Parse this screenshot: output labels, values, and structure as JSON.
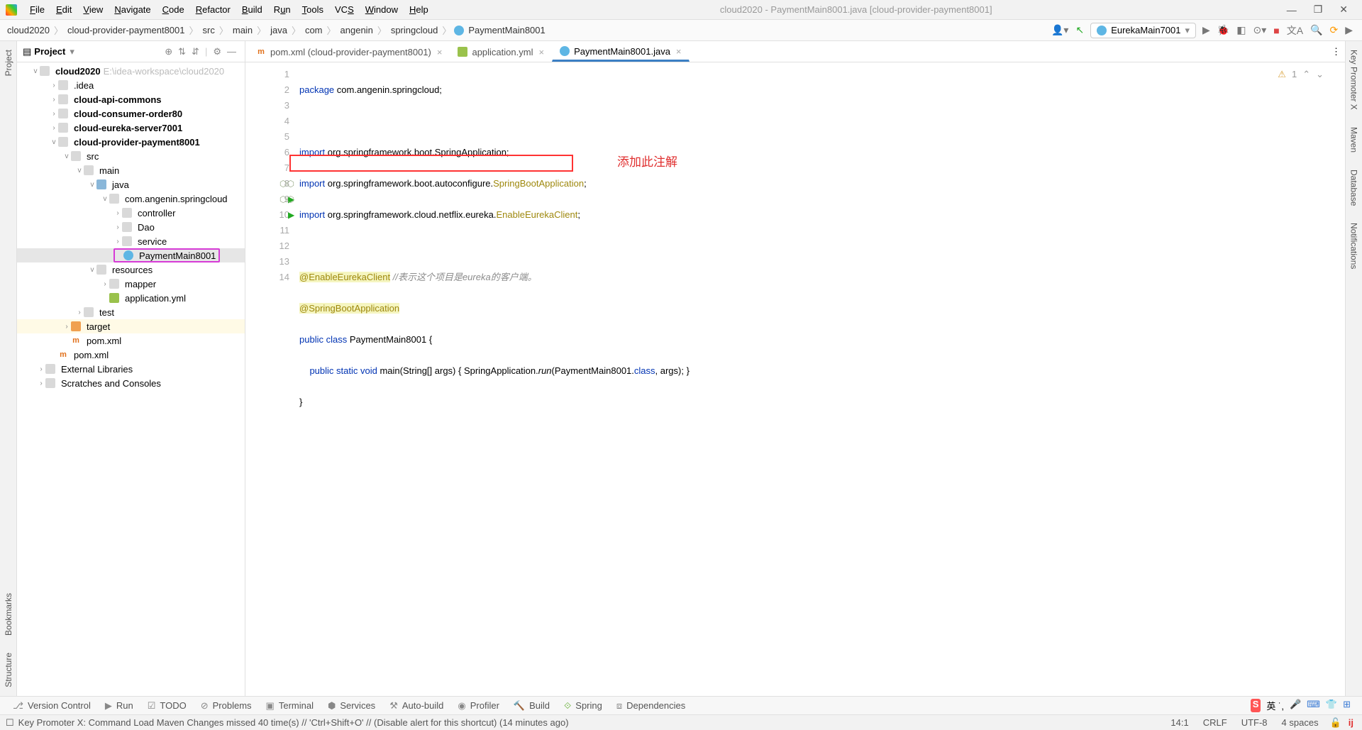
{
  "window": {
    "title": "cloud2020 - PaymentMain8001.java [cloud-provider-payment8001]"
  },
  "menu": [
    "File",
    "Edit",
    "View",
    "Navigate",
    "Code",
    "Refactor",
    "Build",
    "Run",
    "Tools",
    "VCS",
    "Window",
    "Help"
  ],
  "breadcrumbs": [
    "cloud2020",
    "cloud-provider-payment8001",
    "src",
    "main",
    "java",
    "com",
    "angenin",
    "springcloud",
    "PaymentMain8001"
  ],
  "runconfig": "EurekaMain7001",
  "project": {
    "title": "Project",
    "root": {
      "name": "cloud2020",
      "hint": "E:\\idea-workspace\\cloud2020"
    },
    "items": [
      {
        "d": 1,
        "ar": "›",
        "i": "folder",
        "name": ".idea"
      },
      {
        "d": 1,
        "ar": "›",
        "i": "folder",
        "name": "cloud-api-commons",
        "bold": true
      },
      {
        "d": 1,
        "ar": "›",
        "i": "folder",
        "name": "cloud-consumer-order80",
        "bold": true
      },
      {
        "d": 1,
        "ar": "›",
        "i": "folder",
        "name": "cloud-eureka-server7001",
        "bold": true
      },
      {
        "d": 1,
        "ar": "v",
        "i": "folder",
        "name": "cloud-provider-payment8001",
        "bold": true
      },
      {
        "d": 2,
        "ar": "v",
        "i": "folder",
        "name": "src"
      },
      {
        "d": 3,
        "ar": "v",
        "i": "folder",
        "name": "main"
      },
      {
        "d": 4,
        "ar": "v",
        "i": "blue",
        "name": "java"
      },
      {
        "d": 5,
        "ar": "v",
        "i": "folder",
        "name": "com.angenin.springcloud"
      },
      {
        "d": 6,
        "ar": "›",
        "i": "folder",
        "name": "controller"
      },
      {
        "d": 6,
        "ar": "›",
        "i": "folder",
        "name": "Dao"
      },
      {
        "d": 6,
        "ar": "›",
        "i": "folder",
        "name": "service"
      },
      {
        "d": 6,
        "ar": "",
        "i": "c",
        "name": "PaymentMain8001",
        "sel": true,
        "box": true
      },
      {
        "d": 4,
        "ar": "v",
        "i": "folder",
        "name": "resources"
      },
      {
        "d": 5,
        "ar": "›",
        "i": "folder",
        "name": "mapper"
      },
      {
        "d": 5,
        "ar": "",
        "i": "y",
        "name": "application.yml"
      },
      {
        "d": 3,
        "ar": "›",
        "i": "folder",
        "name": "test"
      },
      {
        "d": 2,
        "ar": "›",
        "i": "orange",
        "name": "target",
        "hl": true
      },
      {
        "d": 2,
        "ar": "",
        "i": "m",
        "name": "pom.xml"
      },
      {
        "d": 1,
        "ar": "",
        "i": "m",
        "name": "pom.xml"
      },
      {
        "d": 0,
        "ar": "›",
        "i": "folder",
        "name": "External Libraries"
      },
      {
        "d": 0,
        "ar": "›",
        "i": "folder",
        "name": "Scratches and Consoles"
      }
    ]
  },
  "tabs": [
    {
      "icon": "m",
      "label": "pom.xml (cloud-provider-payment8001)",
      "active": false
    },
    {
      "icon": "y",
      "label": "application.yml",
      "active": false
    },
    {
      "icon": "c",
      "label": "PaymentMain8001.java",
      "active": true
    }
  ],
  "code": {
    "lines": [
      1,
      2,
      3,
      4,
      5,
      6,
      7,
      8,
      9,
      10,
      11,
      12,
      13,
      14
    ],
    "l1_kw": "package",
    "l1_rest": " com.angenin.springcloud;",
    "l3_kw": "import",
    "l3_rest": " org.springframework.boot.SpringApplication;",
    "l4_kw": "import",
    "l4_rest": " org.springframework.boot.autoconfigure.",
    "l4_cls": "SpringBootApplication",
    "l4_end": ";",
    "l5_kw": "import",
    "l5_rest": " org.springframework.cloud.netflix.eureka.",
    "l5_cls": "EnableEurekaClient",
    "l5_end": ";",
    "l7_ann": "@EnableEurekaClient",
    "l7_com": " //表示这个项目是eureka的客户端。",
    "l8_ann": "@SpringBootApplication",
    "l9_kw": "public class ",
    "l9_cls": "PaymentMain8001",
    "l9_end": " {",
    "l10_kw": "    public static void ",
    "l10_fn": "main",
    "l10_p": "(String[] args) { ",
    "l10_call": "SpringApplication.",
    "l10_run": "run",
    "l10_args": "(PaymentMain8001.",
    "l10_class": "class",
    "l10_end": ", args); }",
    "l11": "}",
    "annotation_red": "添加此注解",
    "warn_count": "1"
  },
  "bottombar": [
    "Version Control",
    "Run",
    "TODO",
    "Problems",
    "Terminal",
    "Services",
    "Auto-build",
    "Profiler",
    "Build",
    "Spring",
    "Dependencies"
  ],
  "statusbar": {
    "msg": "Key Promoter X: Command Load Maven Changes missed 40 time(s) // 'Ctrl+Shift+O' // (Disable alert for this shortcut) (14 minutes ago)",
    "pos": "14:1",
    "enc": "CRLF",
    "charset": "UTF-8",
    "indent": "4 spaces"
  },
  "lstrip": [
    "Project",
    "Bookmarks",
    "Structure"
  ],
  "rstrip": [
    "Key Promoter X",
    "Maven",
    "Database",
    "Notifications"
  ]
}
